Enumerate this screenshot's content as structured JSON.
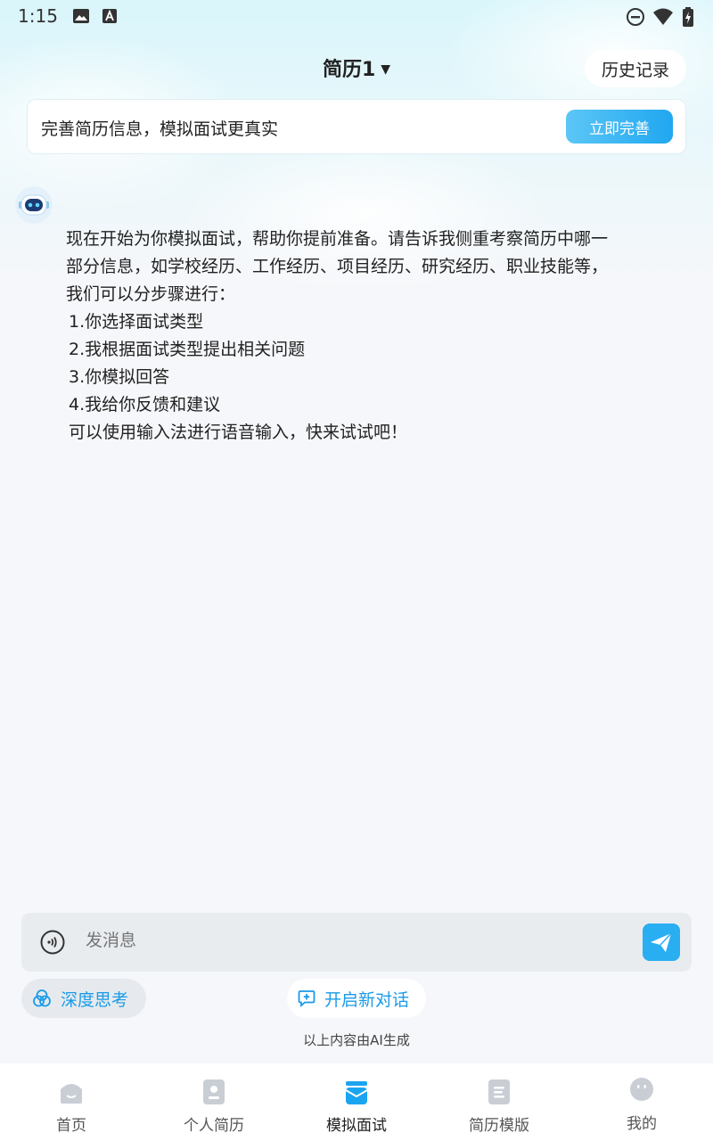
{
  "status_bar": {
    "time": "1:15"
  },
  "header": {
    "title": "简历1",
    "history_label": "历史记录"
  },
  "banner": {
    "text": "完善简历信息，模拟面试更真实",
    "button_label": "立即完善"
  },
  "message": {
    "lines": [
      "现在开始为你模拟面试，帮助你提前准备。请告诉我侧重考察简历中哪一",
      "部分信息，如学校经历、工作经历、项目经历、研究经历、职业技能等，",
      "我们可以分步骤进行：",
      "1.你选择面试类型",
      "2.我根据面试类型提出相关问题",
      "3.你模拟回答",
      "4.我给你反馈和建议",
      "可以使用输入法进行语音输入，快来试试吧！"
    ]
  },
  "input": {
    "placeholder": "发消息"
  },
  "chips": {
    "deep_think": "深度思考",
    "new_chat": "开启新对话"
  },
  "ai_note": "以上内容由AI生成",
  "nav": {
    "items": [
      {
        "label": "首页",
        "icon": "home-icon"
      },
      {
        "label": "个人简历",
        "icon": "resume-icon"
      },
      {
        "label": "模拟面试",
        "icon": "interview-icon"
      },
      {
        "label": "简历模版",
        "icon": "template-icon"
      },
      {
        "label": "我的",
        "icon": "profile-icon"
      }
    ],
    "active_index": 2
  },
  "colors": {
    "accent": "#1aa5f0",
    "chip_text": "#1a9be8",
    "background": "#f6f7fa"
  }
}
